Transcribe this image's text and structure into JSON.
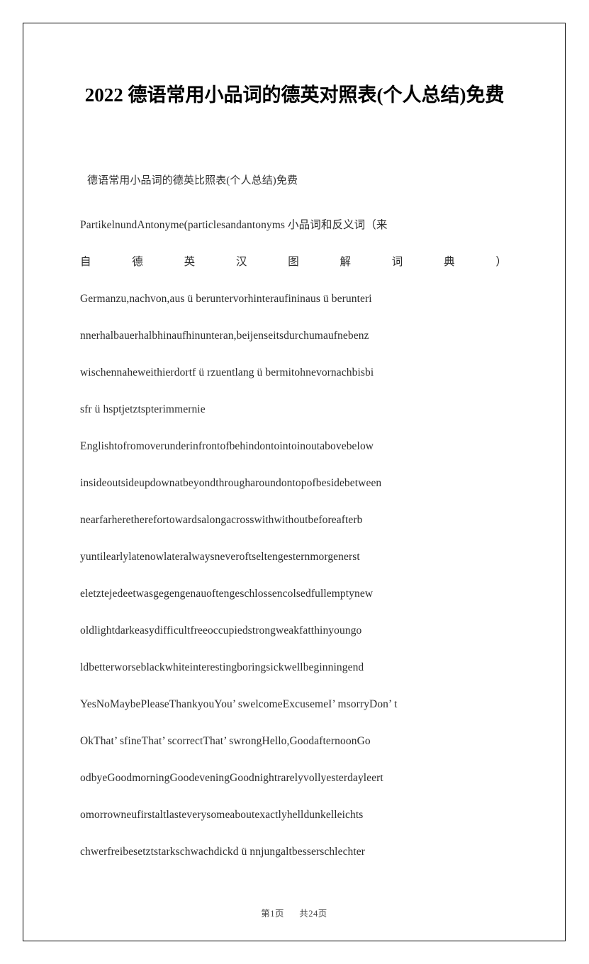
{
  "document": {
    "title": " 2022 德语常用小品词的德英对照表(个人总结)免费",
    "subtitle": "德语常用小品词的德英比照表(个人总结)免费",
    "paragraphs": [
      "PartikelnundAntonyme(particlesandantonyms 小品词和反义词（来",
      "Germanzu,nachvon,aus ü beruntervorhinteraufininaus ü berunteri",
      "nnerhalbauerhalbhinaufhinunteran,beijenseitsdurchumaufnebenz",
      "wischennaheweithierdortf ü rzuentlang ü bermitohnevornachbisbi",
      "sfr ü hsptjetztspterimmernie",
      "Englishtofromoverunderinfrontofbehindontointoinoutabovebelow",
      "insideoutsideupdownatbeyondthrougharoundontopofbesidebetween",
      "nearfarheretherefortowardsalongacrosswithwithoutbeforeafterb",
      "yuntilearlylatenowlateralwaysneveroftseltengesternmorgenerst",
      "eletztejedeetwasgegengenauoftengeschlossencolsedfullemptynew",
      "oldlightdarkeasydifficultfreeoccupiedstrongweakfatthinyoungo",
      "ldbetterworseblackwhiteinterestingboringsickwellbeginningend",
      "YesNoMaybePleaseThankyouYou’ swelcomeExcusemeI’ msorryDon’ t",
      "OkThat’ sfineThat’ scorrectThat’ swrongHello,GoodafternoonGo",
      "odbyeGoodmorningGoodeveningGoodnightrarelyvollyesterdayleert",
      "omorrowneufirstaltlasteverysomeaboutexactlyhelldunkelleichts",
      "chwerfreibesetztstarkschwachdickd ü nnjungaltbesserschlechter"
    ],
    "spread_line": {
      "chars": [
        "自",
        "德",
        "英",
        "汉",
        "图",
        "解",
        "词",
        "典",
        "）"
      ]
    }
  },
  "footer": {
    "current": "第1页",
    "total": "共24页"
  }
}
